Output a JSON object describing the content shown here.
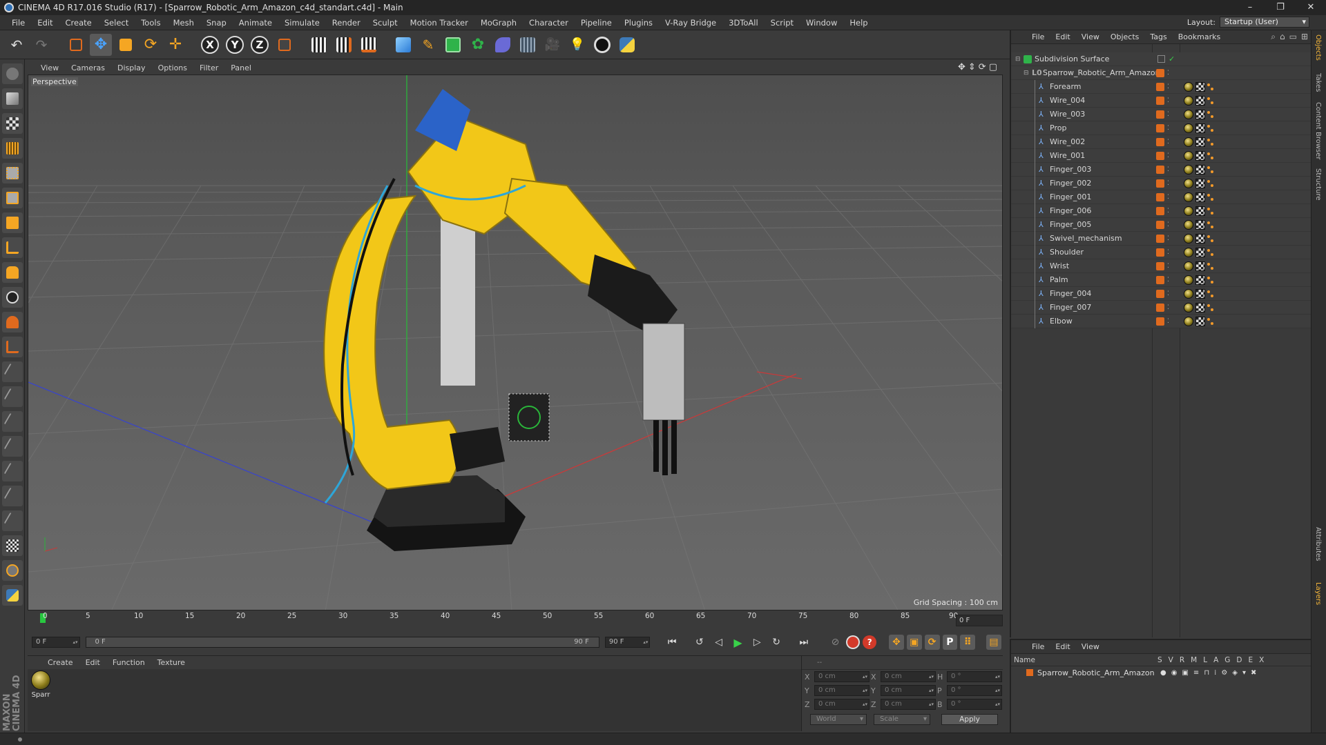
{
  "window": {
    "title": "CINEMA 4D R17.016 Studio (R17) - [Sparrow_Robotic_Arm_Amazon_c4d_standart.c4d] - Main",
    "controls": [
      "–",
      "❐",
      "✕"
    ]
  },
  "menubar": {
    "items": [
      "File",
      "Edit",
      "Create",
      "Select",
      "Tools",
      "Mesh",
      "Snap",
      "Animate",
      "Simulate",
      "Render",
      "Sculpt",
      "Motion Tracker",
      "MoGraph",
      "Character",
      "Pipeline",
      "Plugins",
      "V-Ray Bridge",
      "3DToAll",
      "Script",
      "Window",
      "Help"
    ],
    "layout_label": "Layout:",
    "layout_value": "Startup (User)"
  },
  "toolbar": {
    "axis_x": "X",
    "axis_y": "Y",
    "axis_z": "Z"
  },
  "viewport": {
    "menu": [
      "View",
      "Cameras",
      "Display",
      "Options",
      "Filter",
      "Panel"
    ],
    "label": "Perspective",
    "grid_spacing": "Grid Spacing : 100 cm",
    "nav_icons": [
      "✥",
      "⇕",
      "⟳",
      "▢"
    ]
  },
  "timeline": {
    "ticks": [
      "0",
      "5",
      "10",
      "15",
      "20",
      "25",
      "30",
      "35",
      "40",
      "45",
      "50",
      "55",
      "60",
      "65",
      "70",
      "75",
      "80",
      "85",
      "90"
    ],
    "current_frame_right": "0 F"
  },
  "transport": {
    "start_field": "0 F",
    "range_start": "0 F",
    "range_end": "90 F",
    "end_field": "90 F"
  },
  "materials": {
    "menu": [
      "Create",
      "Edit",
      "Function",
      "Texture"
    ],
    "items": [
      {
        "name": "Sparr"
      }
    ]
  },
  "coordinates": {
    "header": "--",
    "rows": [
      {
        "l1": "X",
        "v1": "0 cm",
        "l2": "X",
        "v2": "0 cm",
        "l3": "H",
        "v3": "0 °"
      },
      {
        "l1": "Y",
        "v1": "0 cm",
        "l2": "Y",
        "v2": "0 cm",
        "l3": "P",
        "v3": "0 °"
      },
      {
        "l1": "Z",
        "v1": "0 cm",
        "l2": "Z",
        "v2": "0 cm",
        "l3": "B",
        "v3": "0 °"
      }
    ],
    "world": "World",
    "scale": "Scale",
    "apply": "Apply"
  },
  "object_manager": {
    "menu": [
      "File",
      "Edit",
      "View",
      "Objects",
      "Tags",
      "Bookmarks"
    ],
    "root": "Subdivision Surface",
    "group": "Sparrow_Robotic_Arm_Amazon",
    "children": [
      "Forearm",
      "Wire_004",
      "Wire_003",
      "Prop",
      "Wire_002",
      "Wire_001",
      "Finger_003",
      "Finger_002",
      "Finger_001",
      "Finger_006",
      "Finger_005",
      "Swivel_mechanism",
      "Shoulder",
      "Wrist",
      "Palm",
      "Finger_004",
      "Finger_007",
      "Elbow"
    ]
  },
  "layer_manager": {
    "menu": [
      "File",
      "Edit",
      "View"
    ],
    "name_header": "Name",
    "col_headers": [
      "S",
      "V",
      "R",
      "M",
      "L",
      "A",
      "G",
      "D",
      "E",
      "X"
    ],
    "layers": [
      {
        "name": "Sparrow_Robotic_Arm_Amazon"
      }
    ]
  },
  "side_tabs": [
    "Objects",
    "Takes",
    "Content Browser",
    "Structure",
    "Attributes",
    "Layers"
  ],
  "maxon_logo": "MAXON CINEMA 4D",
  "colors": {
    "accent_orange": "#e06a1e",
    "robot_yellow": "#f2c718",
    "play_green": "#39d24a"
  }
}
